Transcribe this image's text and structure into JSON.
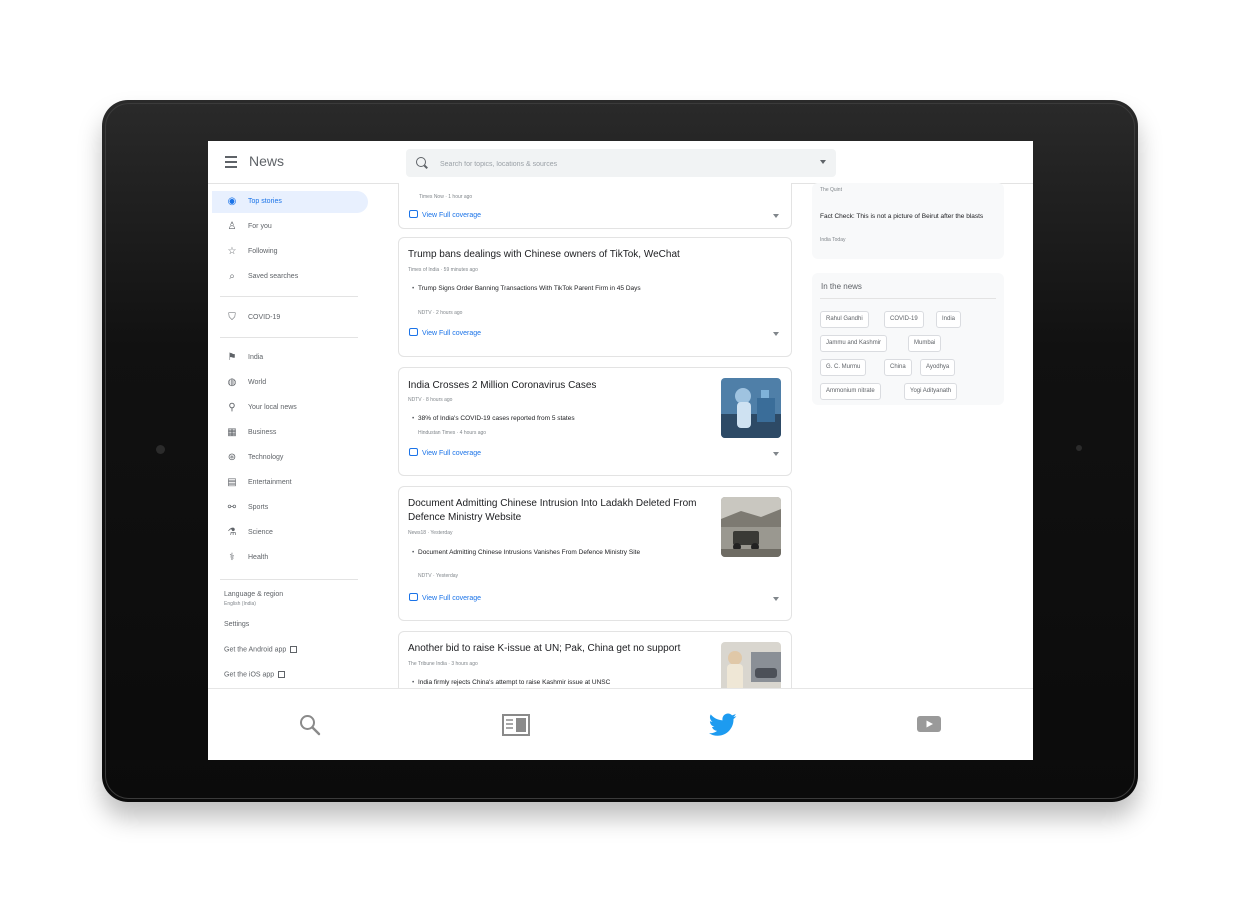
{
  "header": {
    "app_title": "News",
    "search_placeholder": "Search for topics, locations & sources"
  },
  "sidebar": {
    "items": [
      {
        "label": "Top stories",
        "icon": "globe-icon"
      },
      {
        "label": "For you",
        "icon": "person-icon"
      },
      {
        "label": "Following",
        "icon": "star-icon"
      },
      {
        "label": "Saved searches",
        "icon": "search-icon"
      },
      {
        "label": "COVID-19",
        "icon": "shield-icon"
      },
      {
        "label": "India",
        "icon": "flag-icon"
      },
      {
        "label": "World",
        "icon": "world-icon"
      },
      {
        "label": "Your local news",
        "icon": "pin-icon"
      },
      {
        "label": "Business",
        "icon": "building-icon"
      },
      {
        "label": "Technology",
        "icon": "tech-icon"
      },
      {
        "label": "Entertainment",
        "icon": "film-icon"
      },
      {
        "label": "Sports",
        "icon": "bike-icon"
      },
      {
        "label": "Science",
        "icon": "flask-icon"
      },
      {
        "label": "Health",
        "icon": "health-icon"
      }
    ],
    "language_label": "Language & region",
    "language_value": "English (India)",
    "settings": "Settings",
    "android_app": "Get the Android app",
    "ios_app": "Get the iOS app"
  },
  "feed": {
    "partial_card": {
      "meta": "Times Now · 1 hour ago",
      "full_coverage": "View Full coverage"
    },
    "cards": [
      {
        "title": "Trump bans dealings with Chinese owners of TikTok, WeChat",
        "meta": "Times of India · 59 minutes ago",
        "sub_title": "Trump Signs Order Banning Transactions With TikTok Parent Firm in 45 Days",
        "sub_meta": "NDTV · 2 hours ago",
        "full_coverage": "View Full coverage"
      },
      {
        "title": "India Crosses 2 Million Coronavirus Cases",
        "meta": "NDTV · 8 hours ago",
        "sub_title": "38% of India's COVID-19 cases reported from 5 states",
        "sub_meta": "Hindustan Times · 4 hours ago",
        "full_coverage": "View Full coverage"
      },
      {
        "title": "Document Admitting Chinese Intrusion Into Ladakh Deleted From Defence Ministry Website",
        "meta": "News18 · Yesterday",
        "sub_title": "Document Admitting Chinese Intrusions Vanishes From Defence Ministry Site",
        "sub_meta": "NDTV · Yesterday",
        "full_coverage": "View Full coverage"
      },
      {
        "title": "Another bid to raise K-issue at UN; Pak, China get no support",
        "meta": "The Tribune India · 3 hours ago",
        "sub_title": "India firmly rejects China's attempt to raise Kashmir issue at UNSC"
      }
    ]
  },
  "right": {
    "fact_source_top": "The Quint",
    "fact_check": "Fact Check: This is not a picture of Beirut after the blasts",
    "fact_source": "India Today",
    "in_the_news_title": "In the news",
    "chips": [
      "Rahul Gandhi",
      "COVID-19",
      "India",
      "Jammu and Kashmir",
      "Mumbai",
      "G. C. Murmu",
      "China",
      "Ayodhya",
      "Ammonium nitrate",
      "Yogi Adityanath"
    ]
  },
  "bottom_nav": [
    "search-icon",
    "news-reader-icon",
    "twitter-bird-icon",
    "youtube-icon"
  ],
  "colors": {
    "accent": "#1a73e8",
    "twitter": "#1d9bf0",
    "bezel": "#111111"
  }
}
